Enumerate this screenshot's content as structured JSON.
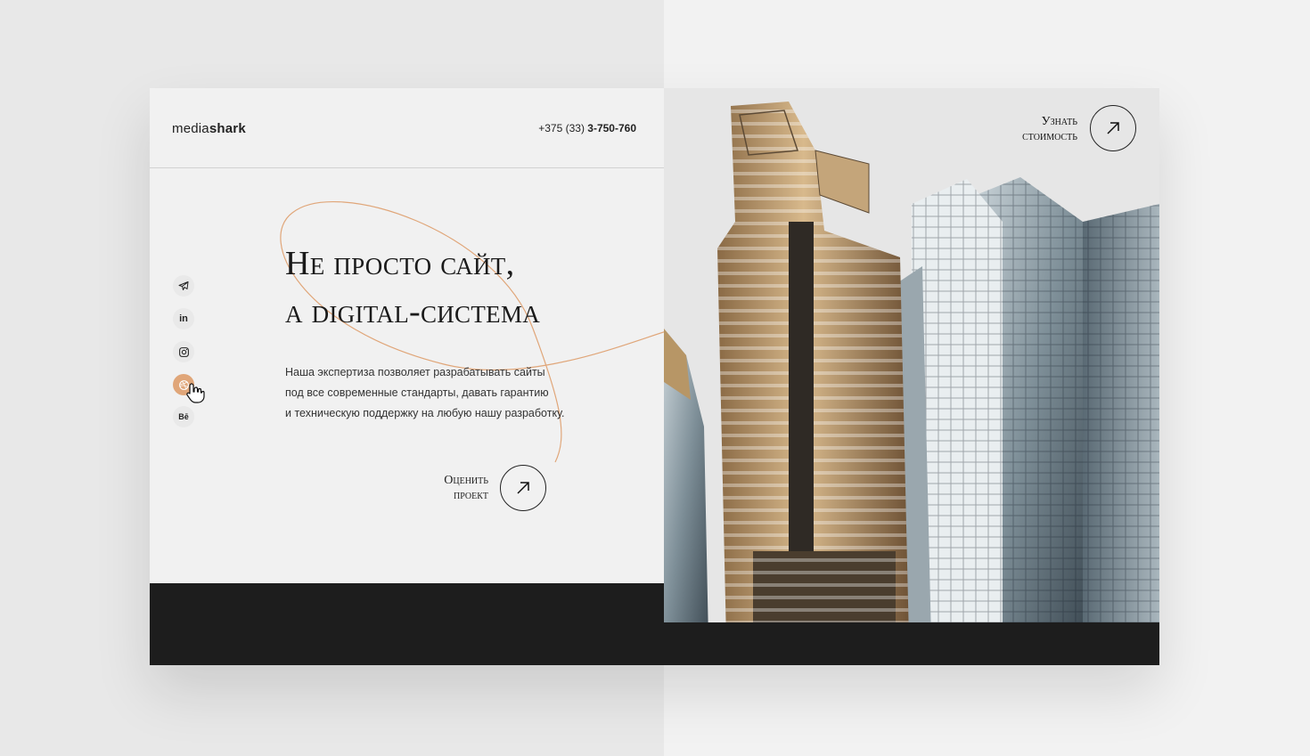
{
  "header": {
    "logo_light": "media",
    "logo_bold": "shark",
    "phone_prefix": "+375 (33) ",
    "phone_number": "3-750-760"
  },
  "hero": {
    "headline_line1": "Не просто сайт,",
    "headline_line2": "а digital-система",
    "lead_line1": "Наша экспертиза позволяет разрабатывать сайты",
    "lead_line2": "под все современные стандарты, давать гарантию",
    "lead_line3": "и техническую поддержку на любую нашу разработку.",
    "cta_line1": "Оценить",
    "cta_line2": "проект"
  },
  "socials": {
    "linkedin_label": "in",
    "behance_label": "Bē"
  },
  "photo_panel": {
    "cta_line1": "Узнать",
    "cta_line2": "стоимость"
  },
  "colors": {
    "accent": "#e0a679",
    "dark": "#1d1d1d",
    "panel": "#f1f1f1"
  }
}
